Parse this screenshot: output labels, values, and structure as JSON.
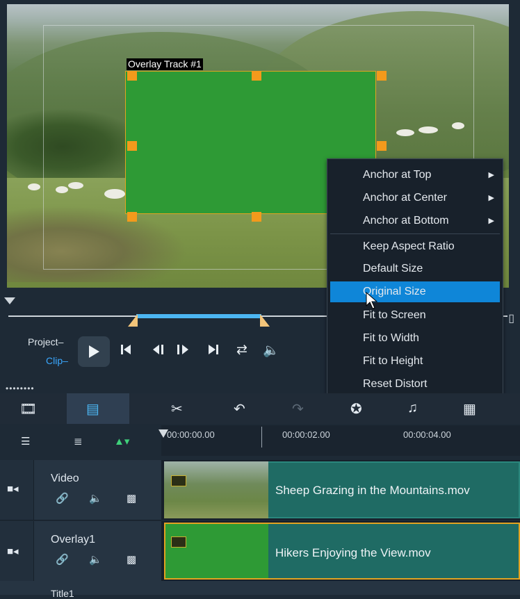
{
  "preview": {
    "overlay_label": "Overlay Track #1"
  },
  "transport": {
    "project_label": "Project–",
    "clip_label": "Clip–",
    "icons": [
      "play-icon",
      "go-to-start-icon",
      "previous-frame-icon",
      "next-frame-icon",
      "go-to-end-icon",
      "repeat-icon",
      "volume-icon"
    ]
  },
  "context_menu": {
    "items": [
      {
        "label": "Anchor at Top",
        "submenu": true
      },
      {
        "label": "Anchor at Center",
        "submenu": true
      },
      {
        "label": "Anchor at Bottom",
        "submenu": true
      },
      {
        "label": "Keep Aspect Ratio",
        "submenu": false
      },
      {
        "label": "Default Size",
        "submenu": false
      },
      {
        "label": "Original Size",
        "submenu": false,
        "highlighted": true
      },
      {
        "label": "Fit to Screen",
        "submenu": false
      },
      {
        "label": "Fit to Width",
        "submenu": false
      },
      {
        "label": "Fit to Height",
        "submenu": false
      },
      {
        "label": "Reset Distort",
        "submenu": false
      }
    ]
  },
  "ruler": {
    "ticks": [
      "00:00:00.00",
      "00:00:02.00",
      "00:00:04.00"
    ]
  },
  "tracks": [
    {
      "name": "Video",
      "clip": "Sheep Grazing in the Mountains.mov"
    },
    {
      "name": "Overlay1",
      "clip": "Hikers Enjoying the View.mov"
    },
    {
      "name": "Title1"
    }
  ],
  "colors": {
    "accent_blue": "#0f86d8",
    "overlay_green": "#2e9a35",
    "handle_orange": "#f39a1c",
    "clip_teal": "#1f6b64"
  }
}
